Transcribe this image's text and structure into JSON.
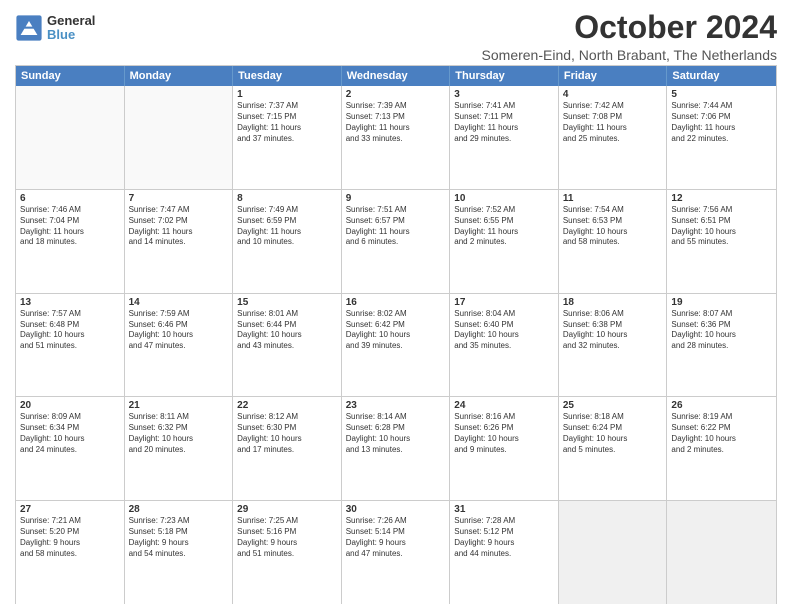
{
  "logo": {
    "general": "General",
    "blue": "Blue"
  },
  "title": "October 2024",
  "subtitle": "Someren-Eind, North Brabant, The Netherlands",
  "headers": [
    "Sunday",
    "Monday",
    "Tuesday",
    "Wednesday",
    "Thursday",
    "Friday",
    "Saturday"
  ],
  "rows": [
    [
      {
        "day": "",
        "text": "",
        "empty": true
      },
      {
        "day": "",
        "text": "",
        "empty": true
      },
      {
        "day": "1",
        "text": "Sunrise: 7:37 AM\nSunset: 7:15 PM\nDaylight: 11 hours\nand 37 minutes."
      },
      {
        "day": "2",
        "text": "Sunrise: 7:39 AM\nSunset: 7:13 PM\nDaylight: 11 hours\nand 33 minutes."
      },
      {
        "day": "3",
        "text": "Sunrise: 7:41 AM\nSunset: 7:11 PM\nDaylight: 11 hours\nand 29 minutes."
      },
      {
        "day": "4",
        "text": "Sunrise: 7:42 AM\nSunset: 7:08 PM\nDaylight: 11 hours\nand 25 minutes."
      },
      {
        "day": "5",
        "text": "Sunrise: 7:44 AM\nSunset: 7:06 PM\nDaylight: 11 hours\nand 22 minutes."
      }
    ],
    [
      {
        "day": "6",
        "text": "Sunrise: 7:46 AM\nSunset: 7:04 PM\nDaylight: 11 hours\nand 18 minutes."
      },
      {
        "day": "7",
        "text": "Sunrise: 7:47 AM\nSunset: 7:02 PM\nDaylight: 11 hours\nand 14 minutes."
      },
      {
        "day": "8",
        "text": "Sunrise: 7:49 AM\nSunset: 6:59 PM\nDaylight: 11 hours\nand 10 minutes."
      },
      {
        "day": "9",
        "text": "Sunrise: 7:51 AM\nSunset: 6:57 PM\nDaylight: 11 hours\nand 6 minutes."
      },
      {
        "day": "10",
        "text": "Sunrise: 7:52 AM\nSunset: 6:55 PM\nDaylight: 11 hours\nand 2 minutes."
      },
      {
        "day": "11",
        "text": "Sunrise: 7:54 AM\nSunset: 6:53 PM\nDaylight: 10 hours\nand 58 minutes."
      },
      {
        "day": "12",
        "text": "Sunrise: 7:56 AM\nSunset: 6:51 PM\nDaylight: 10 hours\nand 55 minutes."
      }
    ],
    [
      {
        "day": "13",
        "text": "Sunrise: 7:57 AM\nSunset: 6:48 PM\nDaylight: 10 hours\nand 51 minutes."
      },
      {
        "day": "14",
        "text": "Sunrise: 7:59 AM\nSunset: 6:46 PM\nDaylight: 10 hours\nand 47 minutes."
      },
      {
        "day": "15",
        "text": "Sunrise: 8:01 AM\nSunset: 6:44 PM\nDaylight: 10 hours\nand 43 minutes."
      },
      {
        "day": "16",
        "text": "Sunrise: 8:02 AM\nSunset: 6:42 PM\nDaylight: 10 hours\nand 39 minutes."
      },
      {
        "day": "17",
        "text": "Sunrise: 8:04 AM\nSunset: 6:40 PM\nDaylight: 10 hours\nand 35 minutes."
      },
      {
        "day": "18",
        "text": "Sunrise: 8:06 AM\nSunset: 6:38 PM\nDaylight: 10 hours\nand 32 minutes."
      },
      {
        "day": "19",
        "text": "Sunrise: 8:07 AM\nSunset: 6:36 PM\nDaylight: 10 hours\nand 28 minutes."
      }
    ],
    [
      {
        "day": "20",
        "text": "Sunrise: 8:09 AM\nSunset: 6:34 PM\nDaylight: 10 hours\nand 24 minutes."
      },
      {
        "day": "21",
        "text": "Sunrise: 8:11 AM\nSunset: 6:32 PM\nDaylight: 10 hours\nand 20 minutes."
      },
      {
        "day": "22",
        "text": "Sunrise: 8:12 AM\nSunset: 6:30 PM\nDaylight: 10 hours\nand 17 minutes."
      },
      {
        "day": "23",
        "text": "Sunrise: 8:14 AM\nSunset: 6:28 PM\nDaylight: 10 hours\nand 13 minutes."
      },
      {
        "day": "24",
        "text": "Sunrise: 8:16 AM\nSunset: 6:26 PM\nDaylight: 10 hours\nand 9 minutes."
      },
      {
        "day": "25",
        "text": "Sunrise: 8:18 AM\nSunset: 6:24 PM\nDaylight: 10 hours\nand 5 minutes."
      },
      {
        "day": "26",
        "text": "Sunrise: 8:19 AM\nSunset: 6:22 PM\nDaylight: 10 hours\nand 2 minutes."
      }
    ],
    [
      {
        "day": "27",
        "text": "Sunrise: 7:21 AM\nSunset: 5:20 PM\nDaylight: 9 hours\nand 58 minutes."
      },
      {
        "day": "28",
        "text": "Sunrise: 7:23 AM\nSunset: 5:18 PM\nDaylight: 9 hours\nand 54 minutes."
      },
      {
        "day": "29",
        "text": "Sunrise: 7:25 AM\nSunset: 5:16 PM\nDaylight: 9 hours\nand 51 minutes."
      },
      {
        "day": "30",
        "text": "Sunrise: 7:26 AM\nSunset: 5:14 PM\nDaylight: 9 hours\nand 47 minutes."
      },
      {
        "day": "31",
        "text": "Sunrise: 7:28 AM\nSunset: 5:12 PM\nDaylight: 9 hours\nand 44 minutes."
      },
      {
        "day": "",
        "text": "",
        "empty": true,
        "shaded": true
      },
      {
        "day": "",
        "text": "",
        "empty": true,
        "shaded": true
      }
    ]
  ]
}
